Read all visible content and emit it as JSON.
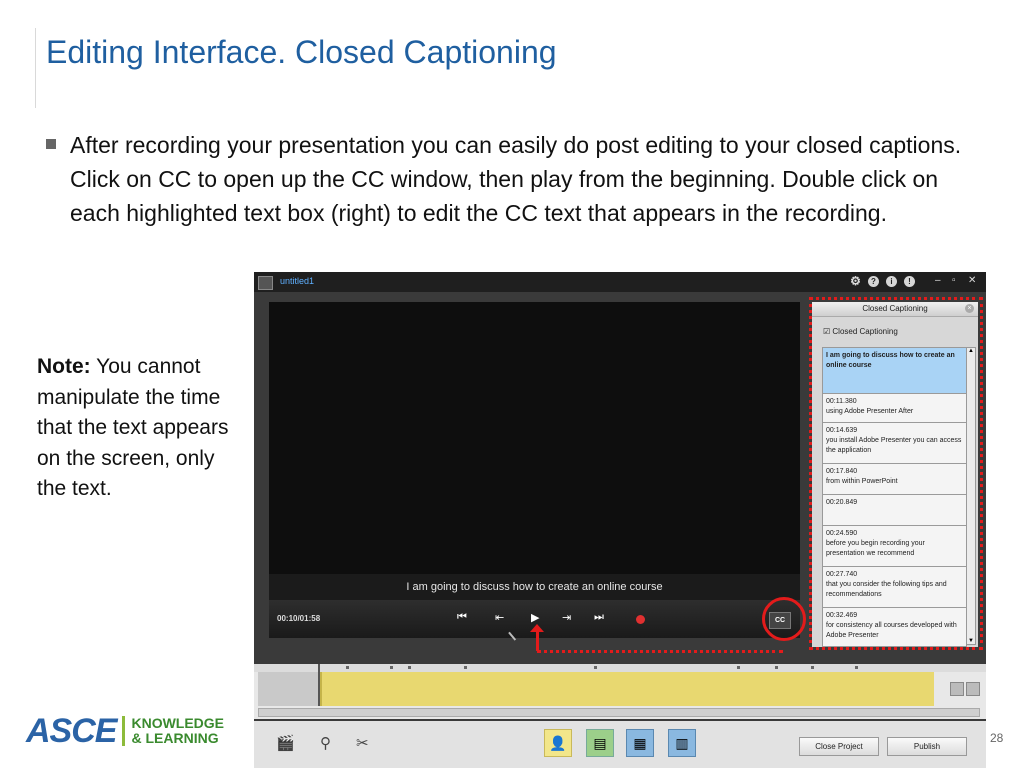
{
  "slide": {
    "title": "Editing Interface. Closed Captioning",
    "bullet": "After recording your presentation you can easily  do post editing to your closed captions. Click on CC to open up the CC window, then play from the beginning. Double click on each highlighted text box (right) to edit the CC text that appears in the recording.",
    "note_label": "Note:",
    "note_text": " You cannot manipulate the time that the text appears on the screen, only the text.",
    "page_number": "28"
  },
  "logo": {
    "brand": "ASCE",
    "line1": "KNOWLEDGE",
    "line2": "& LEARNING"
  },
  "app": {
    "title": "untitled1",
    "caption": "I am going to discuss how to create an online course",
    "time": "00:10/01:58",
    "cc_button": "CC"
  },
  "cc_panel": {
    "title": "Closed Captioning",
    "checkbox_label": "Closed Captioning",
    "items": [
      {
        "time": "",
        "text": "I am going to discuss how to create an online course"
      },
      {
        "time": "00:11.380",
        "text": "using Adobe Presenter After"
      },
      {
        "time": "00:14.639",
        "text": "you install Adobe Presenter you can access the application"
      },
      {
        "time": "00:17.840",
        "text": "from within PowerPoint"
      },
      {
        "time": "00:20.849",
        "text": ""
      },
      {
        "time": "00:24.590",
        "text": "before you begin recording your presentation we recommend"
      },
      {
        "time": "00:27.740",
        "text": "that you consider the following tips and recommendations"
      },
      {
        "time": "00:32.469",
        "text": "for consistency all courses developed with Adobe Presenter"
      }
    ]
  },
  "toolbar": {
    "close_project": "Close Project",
    "publish": "Publish"
  },
  "icons": {
    "settings": "gear-icon",
    "help": "help-icon",
    "info": "info-icon",
    "bulb": "bulb-icon",
    "rewind": "skip-to-start-icon",
    "prev": "previous-slide-icon",
    "play": "play-icon",
    "next": "next-slide-icon",
    "ffwd": "skip-to-end-icon",
    "record": "record-icon"
  }
}
